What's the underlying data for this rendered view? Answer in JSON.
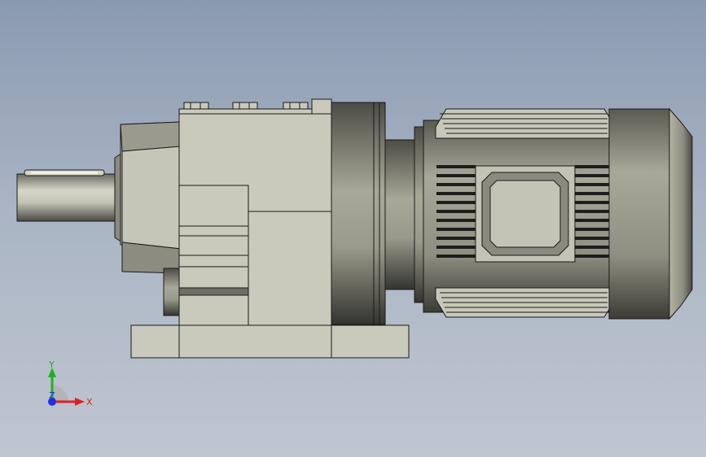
{
  "viewport": {
    "background_top": "#8a9ab0",
    "background_bottom": "#c0c6d0"
  },
  "model": {
    "name": "gear-motor",
    "body_color": "#c8c8bc",
    "outline_color": "#1a1a1a",
    "shading_dark": "#3a3a36",
    "shading_light": "#d8d8cc"
  },
  "triad": {
    "x_label": "X",
    "y_label": "Y",
    "z_label": "Z",
    "x_color": "#e02020",
    "y_color": "#20b020",
    "z_color": "#2030e0"
  }
}
